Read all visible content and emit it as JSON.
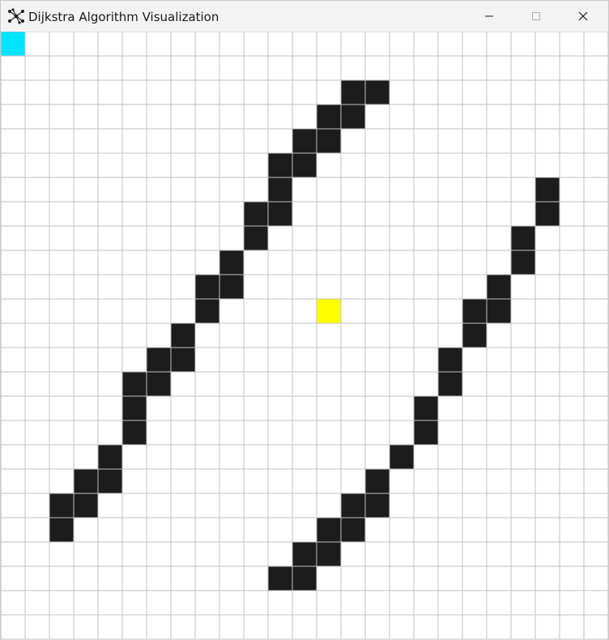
{
  "window": {
    "title": "Dijkstra Algorithm Visualization",
    "icon": "graph-nodes-icon",
    "controls": [
      "minimize-icon",
      "maximize-icon",
      "close-icon"
    ]
  },
  "grid": {
    "columns": 25,
    "rows": 25,
    "line_color": "#c0c0c0",
    "empty_color": "#ffffff",
    "wall_color": "#1c1c1c",
    "start_color": "#00e5ff",
    "end_color": "#ffff00",
    "start": [
      0,
      0
    ],
    "end": [
      13,
      11
    ],
    "walls": [
      [
        14,
        2
      ],
      [
        15,
        2
      ],
      [
        13,
        3
      ],
      [
        14,
        3
      ],
      [
        12,
        4
      ],
      [
        13,
        4
      ],
      [
        11,
        5
      ],
      [
        12,
        5
      ],
      [
        11,
        6
      ],
      [
        22,
        6
      ],
      [
        10,
        7
      ],
      [
        11,
        7
      ],
      [
        22,
        7
      ],
      [
        10,
        8
      ],
      [
        21,
        8
      ],
      [
        9,
        9
      ],
      [
        21,
        9
      ],
      [
        8,
        10
      ],
      [
        9,
        10
      ],
      [
        20,
        10
      ],
      [
        8,
        11
      ],
      [
        19,
        11
      ],
      [
        20,
        11
      ],
      [
        7,
        12
      ],
      [
        19,
        12
      ],
      [
        6,
        13
      ],
      [
        7,
        13
      ],
      [
        18,
        13
      ],
      [
        5,
        14
      ],
      [
        6,
        14
      ],
      [
        18,
        14
      ],
      [
        5,
        15
      ],
      [
        17,
        15
      ],
      [
        5,
        16
      ],
      [
        17,
        16
      ],
      [
        4,
        17
      ],
      [
        16,
        17
      ],
      [
        3,
        18
      ],
      [
        4,
        18
      ],
      [
        15,
        18
      ],
      [
        2,
        19
      ],
      [
        3,
        19
      ],
      [
        14,
        19
      ],
      [
        15,
        19
      ],
      [
        2,
        20
      ],
      [
        13,
        20
      ],
      [
        14,
        20
      ],
      [
        12,
        21
      ],
      [
        13,
        21
      ],
      [
        11,
        22
      ],
      [
        12,
        22
      ]
    ]
  }
}
